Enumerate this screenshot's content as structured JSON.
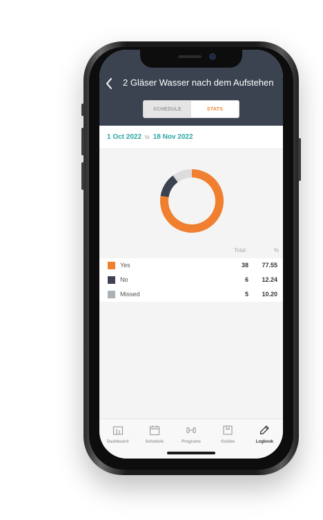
{
  "header": {
    "title": "2 Gläser Wasser nach dem Aufstehen",
    "tabs": [
      {
        "label": "SCHEDULE",
        "active": false
      },
      {
        "label": "STATS",
        "active": true
      }
    ]
  },
  "date_range": {
    "from": "1 Oct 2022",
    "separator": "to",
    "to": "18 Nov 2022"
  },
  "stats": {
    "columns": {
      "total": "Total",
      "percent": "%"
    },
    "rows": [
      {
        "label": "Yes",
        "total": "38",
        "percent": "77.55",
        "color": "#f08030"
      },
      {
        "label": "No",
        "total": "6",
        "percent": "12.24",
        "color": "#3b4350"
      },
      {
        "label": "Missed",
        "total": "5",
        "percent": "10.20",
        "color": "#a9b2b6"
      }
    ]
  },
  "chart_data": {
    "type": "pie",
    "categories": [
      "Yes",
      "No",
      "Missed"
    ],
    "values": [
      77.55,
      12.24,
      10.2
    ],
    "colors": [
      "#f08030",
      "#3b4350",
      "#dcdcdc"
    ]
  },
  "tabbar": {
    "items": [
      {
        "label": "Dashboard",
        "icon": "dashboard-icon",
        "active": false
      },
      {
        "label": "Schedule",
        "icon": "calendar-icon",
        "active": false
      },
      {
        "label": "Programs",
        "icon": "dumbbell-icon",
        "active": false
      },
      {
        "label": "Guides",
        "icon": "book-icon",
        "active": false
      },
      {
        "label": "Logbook",
        "icon": "pencil-icon",
        "active": true
      }
    ]
  },
  "colors": {
    "accent": "#f08030",
    "header_bg": "#3b4350",
    "date_text": "#2aa5a5"
  }
}
